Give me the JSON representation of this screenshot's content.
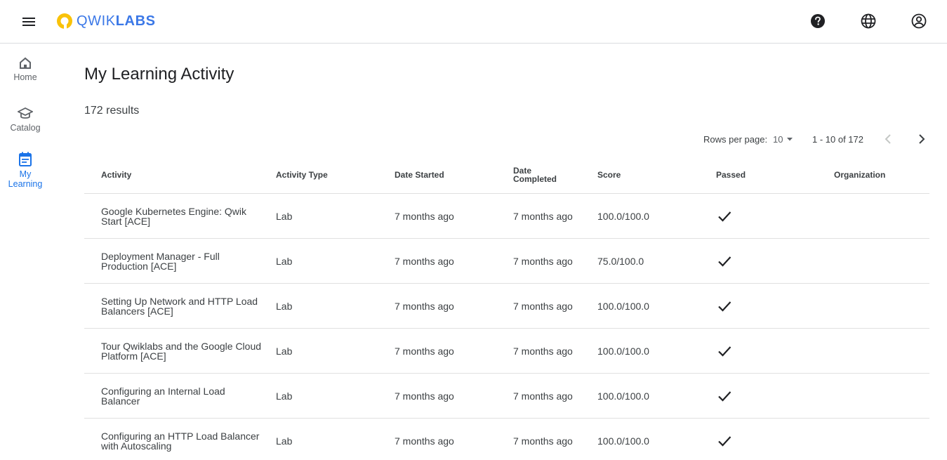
{
  "header": {
    "logo_text_light": "QWIK",
    "logo_text_bold": "LABS",
    "icons": [
      "menu-icon",
      "help-icon",
      "language-icon",
      "account-icon"
    ]
  },
  "sidebar": {
    "items": [
      {
        "label": "Home",
        "icon": "home-icon",
        "active": false
      },
      {
        "label": "Catalog",
        "icon": "catalog-icon",
        "active": false
      },
      {
        "label": "My Learning",
        "icon": "calendar-icon",
        "active": true
      }
    ]
  },
  "main": {
    "title": "My Learning Activity",
    "results": "172 results",
    "pagination": {
      "rows_label": "Rows per page:",
      "rows_value": "10",
      "range": "1 - 10 of 172"
    },
    "table": {
      "columns": [
        "Activity",
        "Activity Type",
        "Date Started",
        "Date Completed",
        "Score",
        "Passed",
        "Organization"
      ],
      "rows": [
        {
          "activity": "Google Kubernetes Engine: Qwik Start [ACE]",
          "type": "Lab",
          "started": "7 months ago",
          "completed": "7 months ago",
          "score": "100.0/100.0",
          "passed": true,
          "organization": ""
        },
        {
          "activity": "Deployment Manager - Full Production [ACE]",
          "type": "Lab",
          "started": "7 months ago",
          "completed": "7 months ago",
          "score": "75.0/100.0",
          "passed": true,
          "organization": ""
        },
        {
          "activity": "Setting Up Network and HTTP Load Balancers [ACE]",
          "type": "Lab",
          "started": "7 months ago",
          "completed": "7 months ago",
          "score": "100.0/100.0",
          "passed": true,
          "organization": ""
        },
        {
          "activity": "Tour Qwiklabs and the Google Cloud Platform [ACE]",
          "type": "Lab",
          "started": "7 months ago",
          "completed": "7 months ago",
          "score": "100.0/100.0",
          "passed": true,
          "organization": ""
        },
        {
          "activity": "Configuring an Internal Load Balancer",
          "type": "Lab",
          "started": "7 months ago",
          "completed": "7 months ago",
          "score": "100.0/100.0",
          "passed": true,
          "organization": ""
        },
        {
          "activity": "Configuring an HTTP Load Balancer with Autoscaling",
          "type": "Lab",
          "started": "7 months ago",
          "completed": "7 months ago",
          "score": "100.0/100.0",
          "passed": true,
          "organization": ""
        }
      ]
    }
  },
  "colors": {
    "accent": "#1a73e8",
    "logo_blue": "#3b78e7",
    "logo_yellow": "#f9c20a"
  }
}
